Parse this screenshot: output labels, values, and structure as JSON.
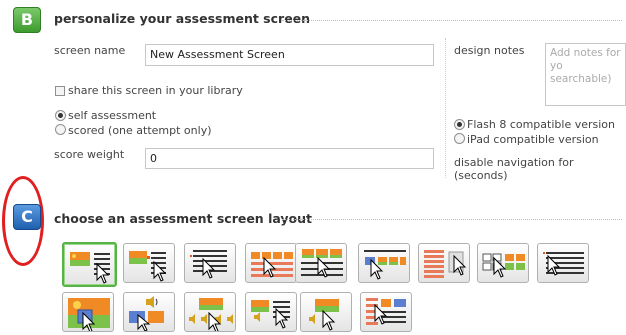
{
  "section_b": {
    "badge": "B",
    "title": "personalize your assessment screen"
  },
  "fields": {
    "screen_name_label": "screen name",
    "screen_name_value": "New Assessment Screen",
    "share_label": "share this screen in your library",
    "self_assessment_label": "self assessment",
    "scored_label": "scored (one attempt only)",
    "score_weight_label": "score weight",
    "score_weight_value": "0"
  },
  "right_panel": {
    "design_notes_label": "design notes",
    "design_notes_placeholder": "Add notes for yo searchable)",
    "flash_label": "Flash 8 compatible version",
    "ipad_label": "iPad compatible version",
    "disable_nav_line1": "disable navigation for",
    "disable_nav_line2": "(seconds)"
  },
  "section_c": {
    "badge": "C",
    "title": "choose an assessment screen layout"
  },
  "layouts": {
    "row1": [
      "image-left-list-right",
      "image-left-list-right-alt",
      "text-list",
      "image-grid-4",
      "image-row-list",
      "image-list-row",
      "list-with-image",
      "grid-cells",
      "lines-list"
    ],
    "row2": [
      "full-image",
      "image-audio",
      "image-row-audio",
      "image-text-list",
      "image-audio-small",
      "image-list-stack"
    ],
    "selected": "image-left-list-right"
  },
  "colors": {
    "accent_green": "#57b345",
    "badge_blue": "#2f6fc4",
    "highlight_red": "#e02020"
  }
}
